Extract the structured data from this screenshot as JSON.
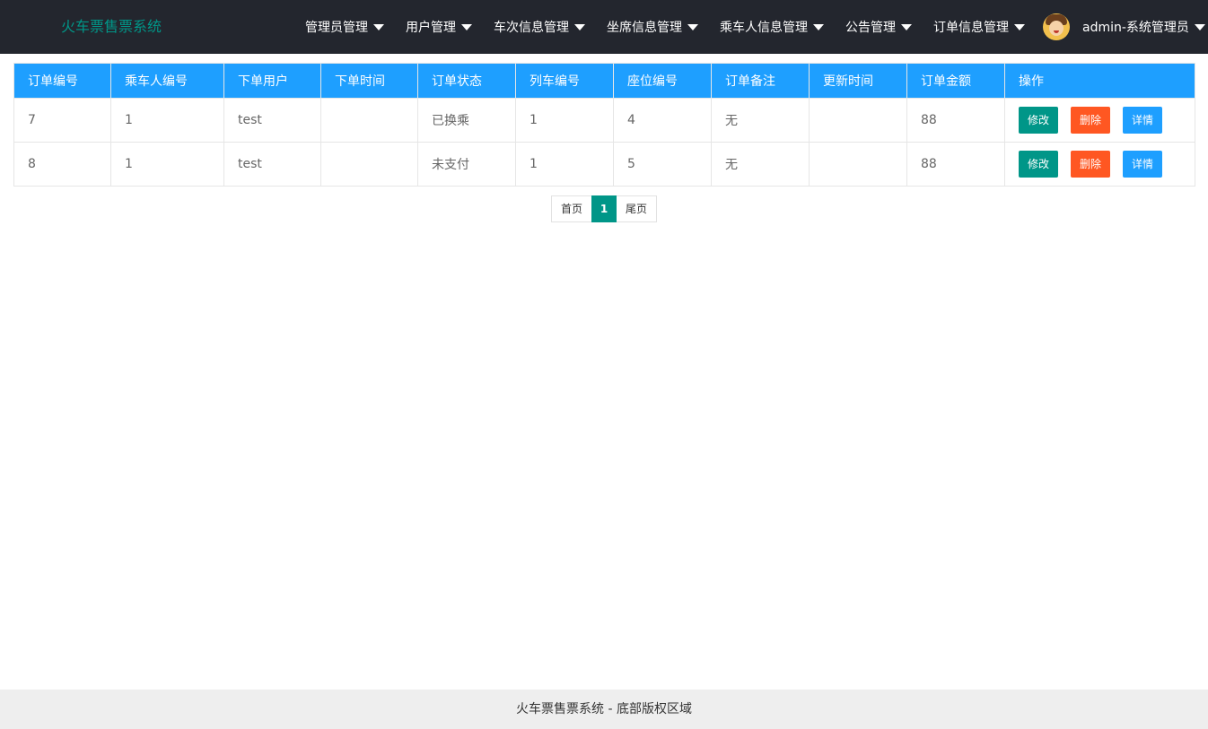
{
  "app": {
    "title": "火车票售票系统"
  },
  "nav": {
    "items": [
      {
        "label": "管理员管理"
      },
      {
        "label": "用户管理"
      },
      {
        "label": "车次信息管理"
      },
      {
        "label": "坐席信息管理"
      },
      {
        "label": "乘车人信息管理"
      },
      {
        "label": "公告管理"
      },
      {
        "label": "订单信息管理"
      }
    ],
    "user": {
      "label": "admin-系统管理员"
    }
  },
  "table": {
    "columns": [
      "订单编号",
      "乘车人编号",
      "下单用户",
      "下单时间",
      "订单状态",
      "列车编号",
      "座位编号",
      "订单备注",
      "更新时间",
      "订单金额",
      "操作"
    ],
    "rows": [
      {
        "order_id": "7",
        "passenger_id": "1",
        "user": "test",
        "order_time": "",
        "status": "已换乘",
        "train_id": "1",
        "seat_id": "4",
        "remark": "无",
        "update_time": "",
        "amount": "88"
      },
      {
        "order_id": "8",
        "passenger_id": "1",
        "user": "test",
        "order_time": "",
        "status": "未支付",
        "train_id": "1",
        "seat_id": "5",
        "remark": "无",
        "update_time": "",
        "amount": "88"
      }
    ],
    "actions": {
      "edit": "修改",
      "delete": "删除",
      "detail": "详情"
    }
  },
  "pagination": {
    "first": "首页",
    "current": "1",
    "last": "尾页"
  },
  "footer": {
    "text": "火车票售票系统 - 底部版权区域"
  },
  "colors": {
    "header_bg": "#23262e",
    "logo": "#009688",
    "table_header": "#1e9fff",
    "edit": "#009688",
    "delete": "#ff5722",
    "detail": "#1e9fff",
    "footer_bg": "#eeeeee"
  }
}
